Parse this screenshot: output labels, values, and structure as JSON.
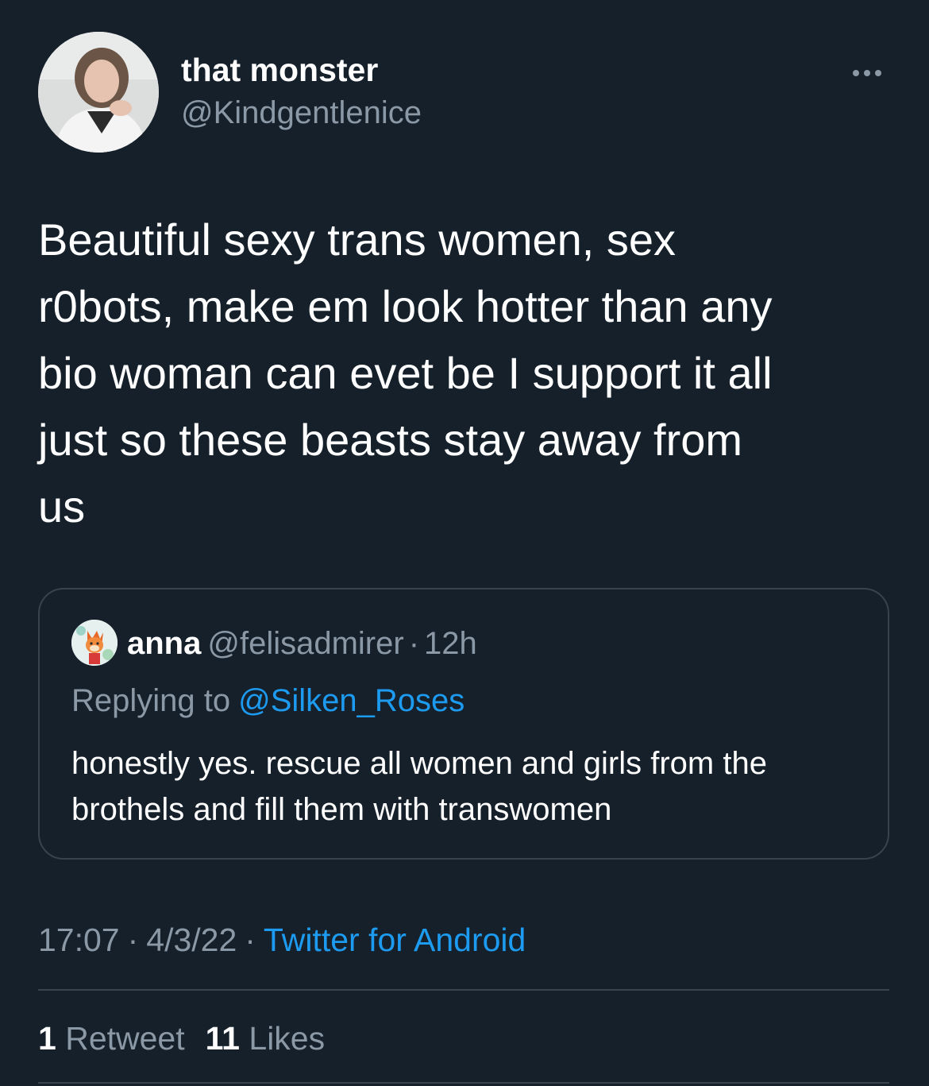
{
  "author": {
    "display_name": "that monster",
    "handle": "@Kindgentlenice",
    "avatar_icon": "profile-photo-avatar"
  },
  "more_icon": "more-options-icon",
  "tweet_text": "Beautiful sexy trans women, sex\nr0bots, make em look hotter than any\nbio woman can evet be I support it all\njust so these beasts stay away from\nus",
  "quoted_tweet": {
    "display_name": "anna",
    "handle": "@felisadmirer",
    "separator": "·",
    "time": "12h",
    "replying_prefix": "Replying to",
    "replying_mention": "@Silken_Roses",
    "text": "honestly yes. rescue all women and girls from the\nbrothels and fill them with transwomen",
    "avatar_icon": "cartoon-avatar"
  },
  "meta": {
    "time": "17:07",
    "separator": "·",
    "date": "4/3/22",
    "source": "Twitter for Android"
  },
  "stats": {
    "retweets_count": "1",
    "retweets_label": "Retweet",
    "likes_count": "11",
    "likes_label": "Likes"
  },
  "colors": {
    "background": "#15202b",
    "text_primary": "#ffffff",
    "text_secondary": "#8b98a5",
    "accent": "#1d9bf0",
    "border": "#38444d"
  }
}
